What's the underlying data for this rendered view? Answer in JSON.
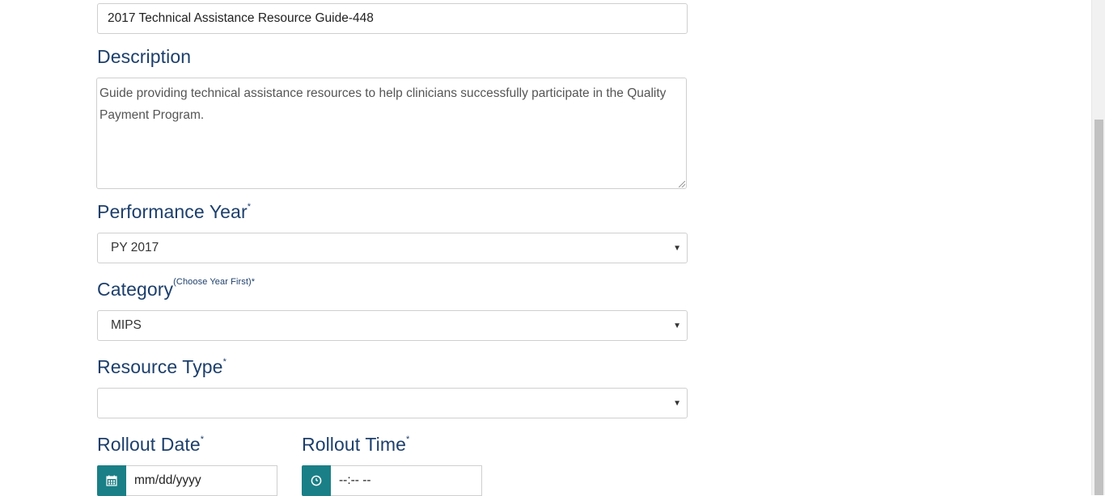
{
  "form": {
    "title_value": "2017 Technical Assistance Resource Guide-448",
    "description_label": "Description",
    "description_value": "Guide providing technical assistance resources to help clinicians successfully participate in the Quality Payment Program.",
    "performance_year_label": "Performance Year",
    "performance_year_required": "*",
    "performance_year_value": "PY 2017",
    "category_label": "Category",
    "category_hint": "(Choose Year First)*",
    "category_value": "MIPS",
    "resource_type_label": "Resource Type",
    "resource_type_required": "*",
    "resource_type_value": "",
    "rollout_date_label": "Rollout Date",
    "rollout_date_required": "*",
    "rollout_date_placeholder": "mm/dd/yyyy",
    "rollout_time_label": "Rollout Time",
    "rollout_time_required": "*",
    "rollout_time_placeholder": "--:-- --"
  },
  "icons": {
    "date_addon": "calendar-icon",
    "time_addon": "clock-icon",
    "select_caret": "caret-down-icon"
  },
  "colors": {
    "label": "#1d3f6b",
    "addon": "#1a7f86"
  }
}
